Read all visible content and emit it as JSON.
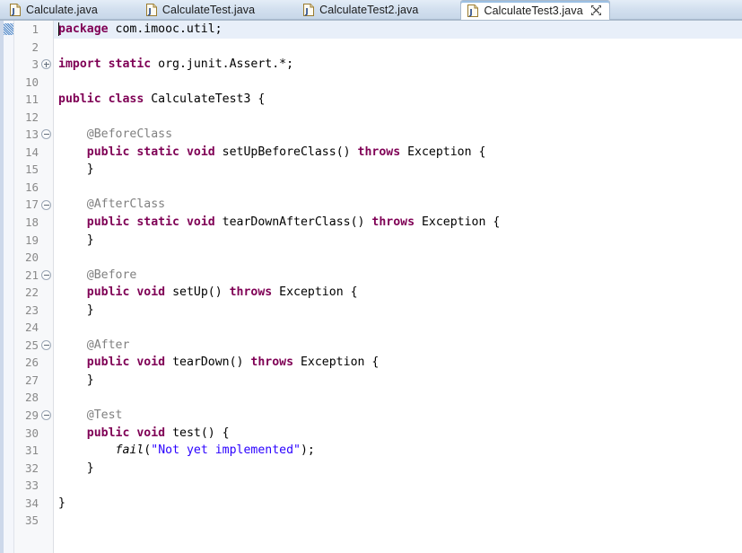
{
  "window": {
    "app": "Eclipse IDE - Java Editor",
    "accent_color": "#9cc0e4",
    "tabbar_bg": "#c6d6e8"
  },
  "tabs": [
    {
      "label": "Calculate.java",
      "icon": "java-file-icon",
      "active": false,
      "closable": false
    },
    {
      "label": "CalculateTest.java",
      "icon": "java-file-icon",
      "active": false,
      "closable": false
    },
    {
      "label": "CalculateTest2.java",
      "icon": "java-file-icon",
      "active": false,
      "closable": false
    },
    {
      "label": "CalculateTest3.java",
      "icon": "java-file-icon",
      "active": true,
      "closable": true,
      "close_icon": "close-icon"
    }
  ],
  "editor": {
    "current_line": 1,
    "caret_line": 1,
    "occurrence_marker_line": 1,
    "line_numbers": [
      "1",
      "2",
      "3",
      "10",
      "11",
      "12",
      "13",
      "14",
      "15",
      "16",
      "17",
      "18",
      "19",
      "20",
      "21",
      "22",
      "23",
      "24",
      "25",
      "26",
      "27",
      "28",
      "29",
      "30",
      "31",
      "32",
      "33",
      "34",
      "35"
    ],
    "folding_markers": [
      {
        "at_index": 2,
        "type": "plus",
        "line": "3"
      },
      {
        "at_index": 6,
        "type": "minus",
        "line": "13"
      },
      {
        "at_index": 10,
        "type": "minus",
        "line": "17"
      },
      {
        "at_index": 14,
        "type": "minus",
        "line": "21"
      },
      {
        "at_index": 18,
        "type": "minus",
        "line": "25"
      },
      {
        "at_index": 22,
        "type": "minus",
        "line": "29"
      }
    ],
    "colors": {
      "keyword": "#7f0055",
      "annotation": "#808080",
      "string": "#2a00ff",
      "plain": "#000000",
      "line_number": "#8a8a8a",
      "current_line_highlight": "#e8eff9"
    },
    "lines": [
      {
        "n": "1",
        "tokens": [
          {
            "t": "package",
            "c": "kw"
          },
          {
            "t": " com.imooc.util;",
            "c": "plain"
          }
        ]
      },
      {
        "n": "2",
        "tokens": []
      },
      {
        "n": "3",
        "tokens": [
          {
            "t": "import",
            "c": "kw"
          },
          {
            "t": " ",
            "c": "plain"
          },
          {
            "t": "static",
            "c": "kw"
          },
          {
            "t": " org.junit.Assert.*;",
            "c": "plain"
          }
        ]
      },
      {
        "n": "10",
        "tokens": []
      },
      {
        "n": "11",
        "tokens": [
          {
            "t": "public",
            "c": "kw"
          },
          {
            "t": " ",
            "c": "plain"
          },
          {
            "t": "class",
            "c": "kw"
          },
          {
            "t": " CalculateTest3 {",
            "c": "plain"
          }
        ]
      },
      {
        "n": "12",
        "tokens": []
      },
      {
        "n": "13",
        "tokens": [
          {
            "t": "    @BeforeClass",
            "c": "ann"
          }
        ]
      },
      {
        "n": "14",
        "tokens": [
          {
            "t": "    ",
            "c": "plain"
          },
          {
            "t": "public",
            "c": "kw"
          },
          {
            "t": " ",
            "c": "plain"
          },
          {
            "t": "static",
            "c": "kw"
          },
          {
            "t": " ",
            "c": "plain"
          },
          {
            "t": "void",
            "c": "kw"
          },
          {
            "t": " setUpBeforeClass() ",
            "c": "plain"
          },
          {
            "t": "throws",
            "c": "kw"
          },
          {
            "t": " Exception {",
            "c": "plain"
          }
        ]
      },
      {
        "n": "15",
        "tokens": [
          {
            "t": "    }",
            "c": "plain"
          }
        ]
      },
      {
        "n": "16",
        "tokens": []
      },
      {
        "n": "17",
        "tokens": [
          {
            "t": "    @AfterClass",
            "c": "ann"
          }
        ]
      },
      {
        "n": "18",
        "tokens": [
          {
            "t": "    ",
            "c": "plain"
          },
          {
            "t": "public",
            "c": "kw"
          },
          {
            "t": " ",
            "c": "plain"
          },
          {
            "t": "static",
            "c": "kw"
          },
          {
            "t": " ",
            "c": "plain"
          },
          {
            "t": "void",
            "c": "kw"
          },
          {
            "t": " tearDownAfterClass() ",
            "c": "plain"
          },
          {
            "t": "throws",
            "c": "kw"
          },
          {
            "t": " Exception {",
            "c": "plain"
          }
        ]
      },
      {
        "n": "19",
        "tokens": [
          {
            "t": "    }",
            "c": "plain"
          }
        ]
      },
      {
        "n": "20",
        "tokens": []
      },
      {
        "n": "21",
        "tokens": [
          {
            "t": "    @Before",
            "c": "ann"
          }
        ]
      },
      {
        "n": "22",
        "tokens": [
          {
            "t": "    ",
            "c": "plain"
          },
          {
            "t": "public",
            "c": "kw"
          },
          {
            "t": " ",
            "c": "plain"
          },
          {
            "t": "void",
            "c": "kw"
          },
          {
            "t": " setUp() ",
            "c": "plain"
          },
          {
            "t": "throws",
            "c": "kw"
          },
          {
            "t": " Exception {",
            "c": "plain"
          }
        ]
      },
      {
        "n": "23",
        "tokens": [
          {
            "t": "    }",
            "c": "plain"
          }
        ]
      },
      {
        "n": "24",
        "tokens": []
      },
      {
        "n": "25",
        "tokens": [
          {
            "t": "    @After",
            "c": "ann"
          }
        ]
      },
      {
        "n": "26",
        "tokens": [
          {
            "t": "    ",
            "c": "plain"
          },
          {
            "t": "public",
            "c": "kw"
          },
          {
            "t": " ",
            "c": "plain"
          },
          {
            "t": "void",
            "c": "kw"
          },
          {
            "t": " tearDown() ",
            "c": "plain"
          },
          {
            "t": "throws",
            "c": "kw"
          },
          {
            "t": " Exception {",
            "c": "plain"
          }
        ]
      },
      {
        "n": "27",
        "tokens": [
          {
            "t": "    }",
            "c": "plain"
          }
        ]
      },
      {
        "n": "28",
        "tokens": []
      },
      {
        "n": "29",
        "tokens": [
          {
            "t": "    @Test",
            "c": "ann"
          }
        ]
      },
      {
        "n": "30",
        "tokens": [
          {
            "t": "    ",
            "c": "plain"
          },
          {
            "t": "public",
            "c": "kw"
          },
          {
            "t": " ",
            "c": "plain"
          },
          {
            "t": "void",
            "c": "kw"
          },
          {
            "t": " test() {",
            "c": "plain"
          }
        ]
      },
      {
        "n": "31",
        "tokens": [
          {
            "t": "        ",
            "c": "plain"
          },
          {
            "t": "fail",
            "c": "stm"
          },
          {
            "t": "(",
            "c": "plain"
          },
          {
            "t": "\"Not yet implemented\"",
            "c": "str"
          },
          {
            "t": ");",
            "c": "plain"
          }
        ]
      },
      {
        "n": "32",
        "tokens": [
          {
            "t": "    }",
            "c": "plain"
          }
        ]
      },
      {
        "n": "33",
        "tokens": []
      },
      {
        "n": "34",
        "tokens": [
          {
            "t": "}",
            "c": "plain"
          }
        ]
      },
      {
        "n": "35",
        "tokens": []
      }
    ]
  }
}
